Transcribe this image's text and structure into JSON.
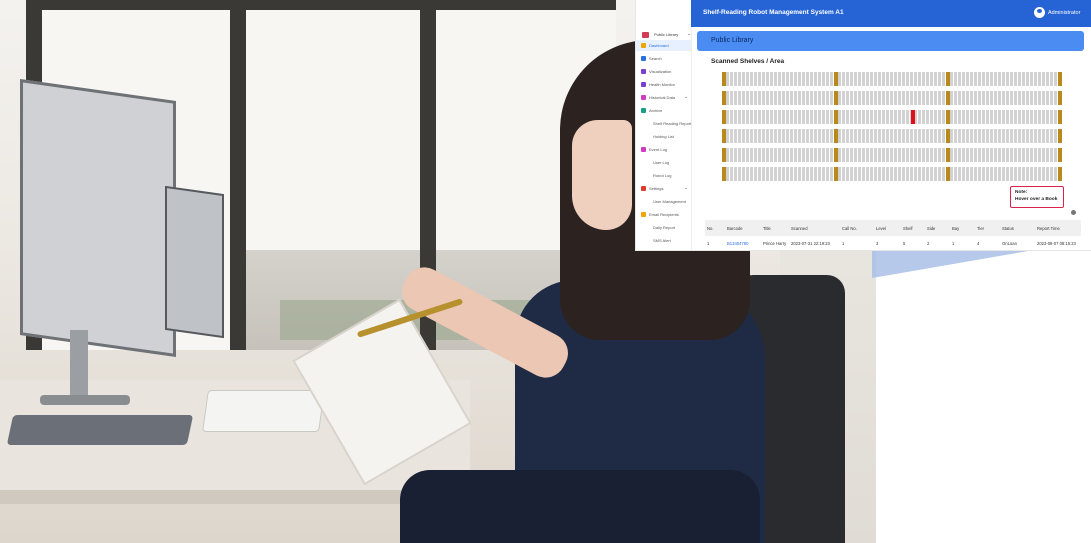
{
  "app": {
    "title": "Shelf-Reading Robot Management System A1",
    "user": "Administrator",
    "accent": "#2664d6"
  },
  "sidebar": {
    "library_select": "Public Library",
    "items": [
      {
        "label": "Dashboard",
        "icon": "dashboard-icon",
        "active": true
      },
      {
        "label": "Search",
        "icon": "search-icon"
      },
      {
        "label": "Visualization",
        "icon": "video-icon"
      },
      {
        "label": "Health Monitor",
        "icon": "heart-icon"
      },
      {
        "label": "Historical Data",
        "icon": "history-icon",
        "expandable": true
      },
      {
        "label": "Archive",
        "icon": "archive-icon"
      },
      {
        "label": "Shelf Reading Report",
        "sub": true
      },
      {
        "label": "Holding List",
        "sub": true
      },
      {
        "label": "Event Log",
        "icon": "calendar-icon"
      },
      {
        "label": "User Log",
        "sub": true
      },
      {
        "label": "Robot Log",
        "sub": true
      },
      {
        "label": "Settings",
        "icon": "gear-icon",
        "expandable": true
      },
      {
        "label": "User Management",
        "sub": true
      },
      {
        "label": "Email Recipients",
        "icon": "mail-icon"
      },
      {
        "label": "Daily Report",
        "sub": true
      },
      {
        "label": "SMS Alert",
        "sub": true
      }
    ]
  },
  "main": {
    "banner": "Public Library",
    "section_title": "Scanned Shelves / Area",
    "note_line1": "Note:",
    "note_line2": "Hover over a Book",
    "shelf_colors": {
      "book": "#d2d2d2",
      "divider": "#b8891c",
      "alert": "#e0101a"
    }
  },
  "table": {
    "columns": [
      "No.",
      "Barcode",
      "Title",
      "Scanned",
      "Call No.",
      "Level",
      "Shelf",
      "Side",
      "Bay",
      "Tier",
      "Status",
      "Report Time"
    ],
    "rows": [
      [
        "1",
        "B13404780",
        "Prince Harry",
        "2023-07-31 22:19:23",
        "1",
        "3",
        "5",
        "2",
        "1",
        "4",
        "OnLoan",
        "2023-08-07 08:15:23"
      ]
    ]
  }
}
